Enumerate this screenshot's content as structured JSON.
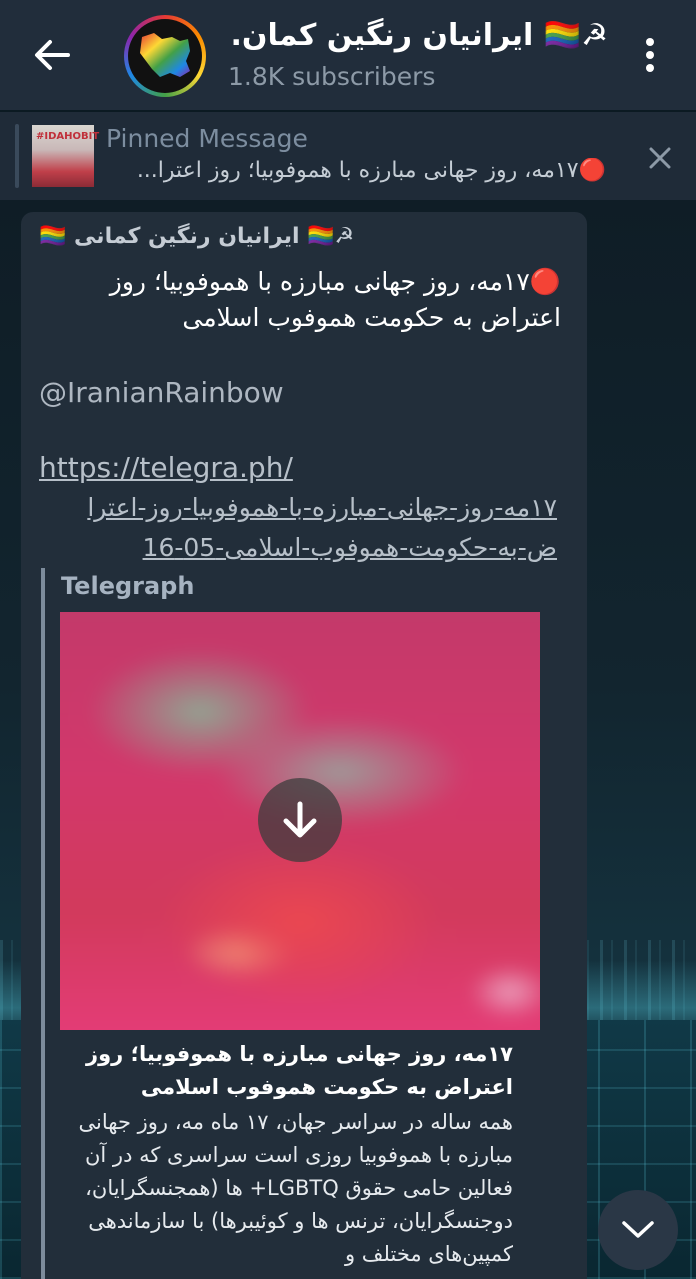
{
  "header": {
    "title": "ایرانیان رنگین کمان...",
    "title_icons": "☭🏳️‍🌈",
    "subscribers": "1.8K subscribers"
  },
  "pinned": {
    "label": "Pinned Message",
    "thumb_text": "#IDAHOBIT",
    "text": "🔴۱۷مه، روز جهانی مبارزه با هموفوبیا؛ روز اعترا..."
  },
  "message": {
    "author": "☭🏳️‍🌈 ایرانیان رنگین کمانی 🏳️‍🌈",
    "text": "🔴۱۷مه، روز جهانی مبارزه با هموفوبیا؛ روز اعتراض به حکومت هموفوب اسلامی",
    "handle": "@IranianRainbow",
    "link_line1": "https://telegra.ph/",
    "link_line2": "۱۷مه-روز-جهانی-مبارزه-با-هموفوبیا-روز-اعترا",
    "link_line3": "ض-به-حکومت-هموفوب-اسلامی-05-16"
  },
  "preview": {
    "site": "Telegraph",
    "title": "۱۷مه، روز جهانی مبارزه با هموفوبیا؛ روز اعتراض به حکومت هموفوب اسلامی",
    "description": "همه ساله در سراسر جهان، ۱۷ ماه مه، روز جهانی مبارزه با هموفوبیا روزی است سراسری که در آن فعالین حامی حقوق LGBTQ+ ها (همجنسگرایان، دوجنسگرایان، ترنس ها و کوئیبرها) با سازماندهی کمپین‌های مختلف و"
  },
  "icons": {
    "back": "arrow-left-icon",
    "menu": "more-vertical-icon",
    "close": "close-icon",
    "download": "download-icon",
    "scroll": "chevron-down-icon"
  }
}
